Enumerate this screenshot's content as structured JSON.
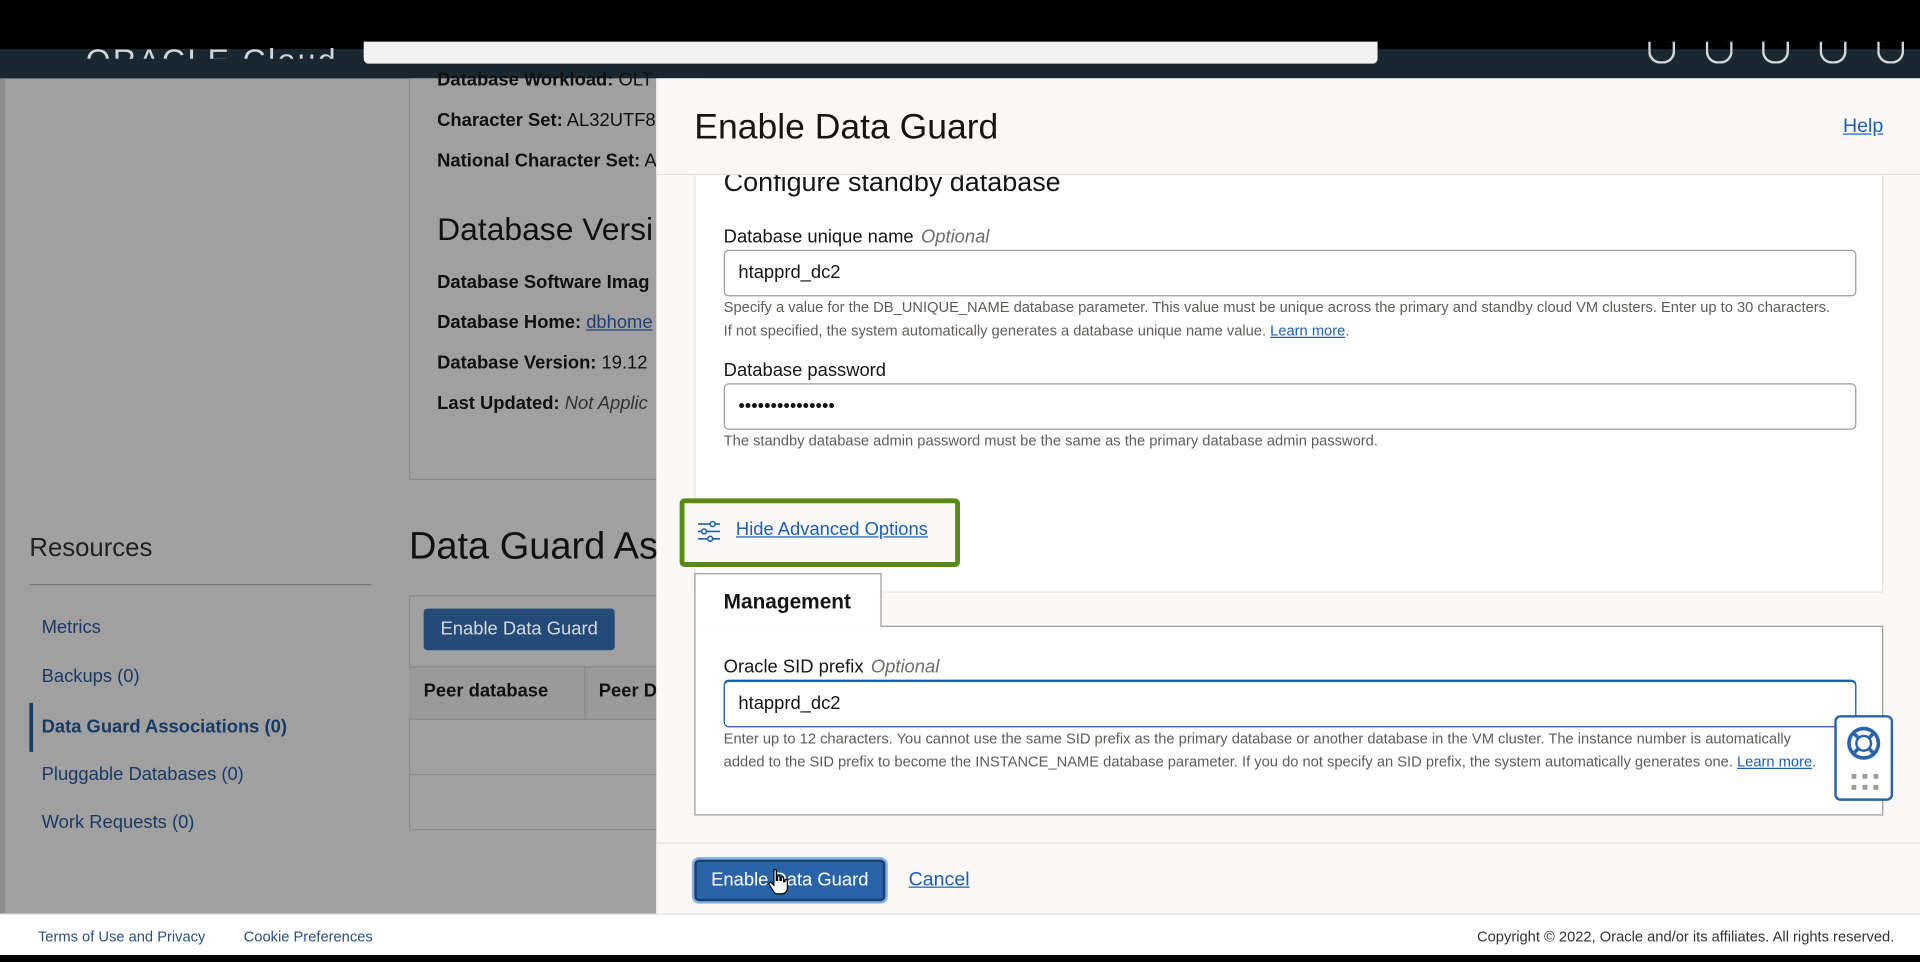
{
  "brand": "ORACLE Cloud",
  "background_page": {
    "details": {
      "workload_label": "Database Workload:",
      "workload_value": "OLT",
      "charset_label": "Character Set:",
      "charset_value": "AL32UTF8",
      "ncharset_label": "National Character Set:",
      "ncharset_value": "A",
      "version_heading": "Database Versi",
      "sw_image_label": "Database Software Imag",
      "home_label": "Database Home:",
      "home_value": "dbhome",
      "version_label": "Database Version:",
      "version_value": "19.12",
      "updated_label": "Last Updated:",
      "updated_value": "Not Applic"
    },
    "resources": {
      "heading": "Resources",
      "items": [
        {
          "label": "Metrics"
        },
        {
          "label": "Backups (0)"
        },
        {
          "label": "Data Guard Associations (0)"
        },
        {
          "label": "Pluggable Databases (0)"
        },
        {
          "label": "Work Requests (0)"
        }
      ]
    },
    "dg_section": {
      "heading": "Data Guard As",
      "button": "Enable Data Guard",
      "col_peer_database": "Peer database",
      "col_peer_d": "Peer D"
    }
  },
  "panel": {
    "title": "Enable Data Guard",
    "help": "Help",
    "section_title": "Configure standby database",
    "unique_name": {
      "label": "Database unique name",
      "optional": "Optional",
      "value": "htapprd_dc2",
      "hint_line1": "Specify a value for the DB_UNIQUE_NAME database parameter. This value must be unique across the primary and standby cloud VM clusters. Enter up to 30 characters.",
      "hint_line2": "If not specified, the system automatically generates a database unique name value.",
      "learn_more": "Learn more"
    },
    "password": {
      "label": "Database password",
      "value": "•••••••••••••••",
      "hint": "The standby database admin password must be the same as the primary database admin password."
    },
    "advanced_link": "Hide Advanced Options",
    "tab_management": "Management",
    "sid": {
      "label": "Oracle SID prefix",
      "optional": "Optional",
      "value": "htapprd_dc2",
      "hint_line1": "Enter up to 12 characters. You cannot use the same SID prefix as the primary database or another database in the VM cluster. The instance number is automatically",
      "hint_line2": "added to the SID prefix to become the INSTANCE_NAME database parameter. If you do not specify an SID prefix, the system automatically generates one.",
      "learn_more": "Learn more"
    },
    "submit": "Enable Data Guard",
    "cancel": "Cancel"
  },
  "footer": {
    "terms": "Terms of Use and Privacy",
    "cookies": "Cookie Preferences",
    "copyright": "Copyright © 2022, Oracle and/or its affiliates. All rights reserved."
  },
  "colors": {
    "accent": "#2a64a8",
    "highlight_border": "#5a8a16",
    "link": "#1c5fb0"
  }
}
